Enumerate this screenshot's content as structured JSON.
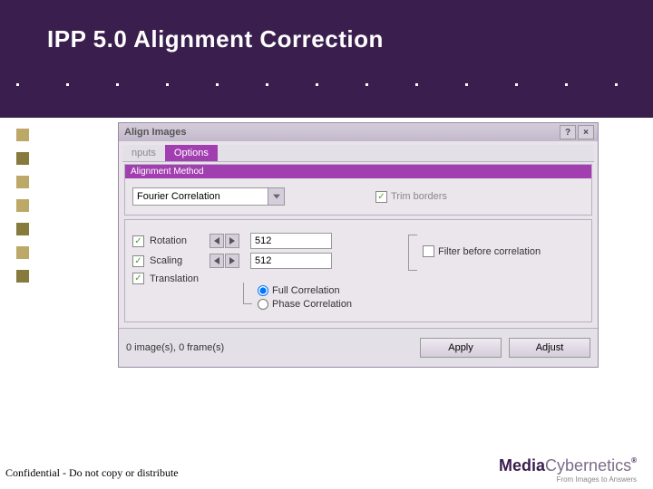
{
  "slide": {
    "title": "IPP 5.0 Alignment Correction",
    "footer": "Confidential - Do not copy or distribute",
    "brand_main": "Media",
    "brand_sub": "Cybernetics",
    "brand_tag": "From Images to Answers"
  },
  "dialog": {
    "title": "Align Images",
    "help": "?",
    "close": "×",
    "tabs": {
      "inputs": "nputs",
      "options": "Options"
    },
    "group_title": "Alignment Method",
    "method": {
      "value": "Fourier Correlation"
    },
    "trim": {
      "label": "Trim borders"
    },
    "rows": {
      "rotation": {
        "label": "Rotation",
        "value": "512"
      },
      "scaling": {
        "label": "Scaling",
        "value": "512"
      },
      "translation": {
        "label": "Translation"
      }
    },
    "filter": {
      "label": "Filter before correlation"
    },
    "radio": {
      "full": "Full Correlation",
      "phase": "Phase Correlation"
    },
    "status": "0 image(s), 0 frame(s)",
    "buttons": {
      "apply": "Apply",
      "adjust": "Adjust"
    }
  }
}
